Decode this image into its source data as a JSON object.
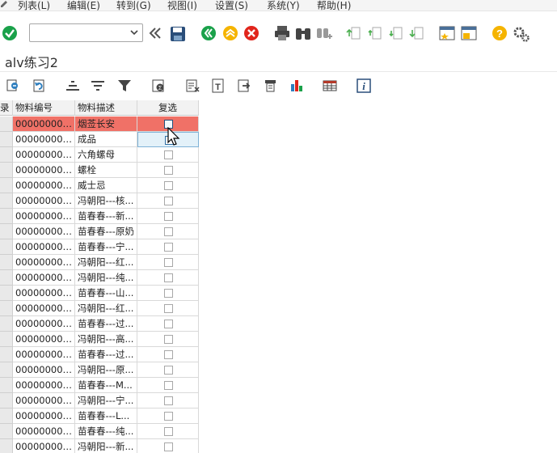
{
  "menu": [
    "列表(L)",
    "编辑(E)",
    "转到(G)",
    "视图(I)",
    "设置(S)",
    "系统(Y)",
    "帮助(H)"
  ],
  "command_field": {
    "value": "",
    "placeholder": ""
  },
  "title": "alv练习2",
  "grid": {
    "row_selector_header": "录",
    "columns": [
      "物料编号",
      "物料描述",
      "复选"
    ],
    "rows": [
      {
        "matnr": "000000000...",
        "desc": "烟莶长安",
        "checked": false
      },
      {
        "matnr": "000000000...",
        "desc": "成品",
        "checked": false
      },
      {
        "matnr": "000000000...",
        "desc": "六角螺母",
        "checked": false
      },
      {
        "matnr": "000000000...",
        "desc": "螺栓",
        "checked": false
      },
      {
        "matnr": "000000000...",
        "desc": "威士忌",
        "checked": false
      },
      {
        "matnr": "000000000...",
        "desc": "冯朝阳---核...",
        "checked": false
      },
      {
        "matnr": "000000000...",
        "desc": "苗春春---新...",
        "checked": false
      },
      {
        "matnr": "000000000...",
        "desc": "苗春春---原奶",
        "checked": false
      },
      {
        "matnr": "000000000...",
        "desc": "苗春春---宁...",
        "checked": false
      },
      {
        "matnr": "000000000...",
        "desc": "冯朝阳---红...",
        "checked": false
      },
      {
        "matnr": "000000000...",
        "desc": "冯朝阳---纯...",
        "checked": false
      },
      {
        "matnr": "000000000...",
        "desc": "苗春春---山...",
        "checked": false
      },
      {
        "matnr": "000000000...",
        "desc": "冯朝阳---红...",
        "checked": false
      },
      {
        "matnr": "000000000...",
        "desc": "苗春春---过...",
        "checked": false
      },
      {
        "matnr": "000000000...",
        "desc": "冯朝阳---高...",
        "checked": false
      },
      {
        "matnr": "000000000...",
        "desc": "苗春春---过...",
        "checked": false
      },
      {
        "matnr": "000000000...",
        "desc": "冯朝阳---原...",
        "checked": false
      },
      {
        "matnr": "000000000...",
        "desc": "苗春春---M...",
        "checked": false
      },
      {
        "matnr": "000000000...",
        "desc": "冯朝阳---宁...",
        "checked": false
      },
      {
        "matnr": "000000000...",
        "desc": "苗春春---L...",
        "checked": false
      },
      {
        "matnr": "000000000...",
        "desc": "苗春春---纯...",
        "checked": false
      },
      {
        "matnr": "000000000...",
        "desc": "冯朝阳---新...",
        "checked": false
      }
    ]
  },
  "icons": {
    "toolbar1": [
      "enter-check-icon",
      "back-icon",
      "exit-icon",
      "cancel-icon",
      "print-icon",
      "find-icon",
      "find-next-icon",
      "first-page-icon",
      "previous-page-icon",
      "next-page-icon",
      "last-page-icon",
      "create-session-icon",
      "shortcut-icon",
      "help-icon",
      "customize-layout-icon"
    ],
    "toolbar2": [
      "details-icon",
      "refresh-icon",
      "sort-ascending-icon",
      "sort-descending-icon",
      "filter-icon",
      "total-icon",
      "export-icon",
      "word-processing-icon",
      "local-file-icon",
      "print-preview-icon",
      "graphic-icon",
      "layout-icon",
      "info-icon"
    ]
  },
  "colors": {
    "highlight_row": "#f07167",
    "ok_green": "#1aa14a",
    "nav_yellow": "#f5b400",
    "cancel_red": "#e1251b",
    "save_blue": "#2a4e7a"
  }
}
